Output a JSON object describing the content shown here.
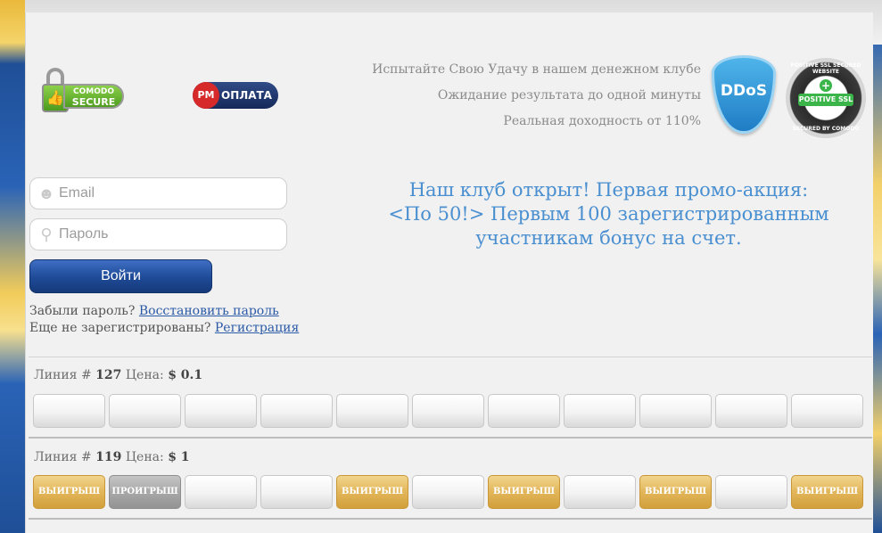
{
  "badges": {
    "comodo_line1": "COMODO",
    "comodo_line2": "SECURE",
    "pm_logo": "PM",
    "pm_label": "ОПЛАТА",
    "ddos_label": "DDoS",
    "ssl_name": "POSITIVE SSL",
    "ssl_ring_top": "POSITIVE SSL SECURED WEBSITE",
    "ssl_ring_bottom": "SECURED BY COMODO"
  },
  "taglines": [
    "Испытайте Свою Удачу в нашем денежном клубе",
    "Ожидание результата до одной минуты",
    "Реальная доходность от 110%"
  ],
  "login": {
    "email_placeholder": "Email",
    "password_placeholder": "Пароль",
    "submit_label": "Войти",
    "forgot_text": "Забыли пароль?",
    "restore_link": "Восстановить пароль",
    "not_registered_text": "Еще не зарегистрированы?",
    "register_link": "Регистрация"
  },
  "promo": {
    "line1": "Наш клуб открыт! Первая промо-акция:",
    "line2": "<По 50!> Первым 100 зарегистрированным",
    "line3": "участникам бонус на счет."
  },
  "lines": [
    {
      "prefix": "Линия #",
      "number": "127",
      "price_label": "Цена:",
      "price": "$ 0.1",
      "cells": [
        "",
        "",
        "",
        "",
        "",
        "",
        "",
        "",
        "",
        "",
        "",
        ""
      ]
    },
    {
      "prefix": "Линия #",
      "number": "119",
      "price_label": "Цена:",
      "price": "$ 1",
      "cells": [
        "ВЫИГРЫШ",
        "ПРОИГРЫШ",
        "",
        "",
        "ВЫИГРЫШ",
        "",
        "ВЫИГРЫШ",
        "",
        "ВЫИГРЫШ",
        "",
        "ВЫИГРЫШ"
      ]
    }
  ],
  "colors": {
    "accent_blue": "#1e4a96",
    "promo_text": "#4a8fd0",
    "win_gold": "#e2b65a",
    "lose_gray": "#a8a8a8"
  },
  "icons": {
    "email": "user-icon",
    "password": "key-icon",
    "comodo": "lock-icon"
  }
}
